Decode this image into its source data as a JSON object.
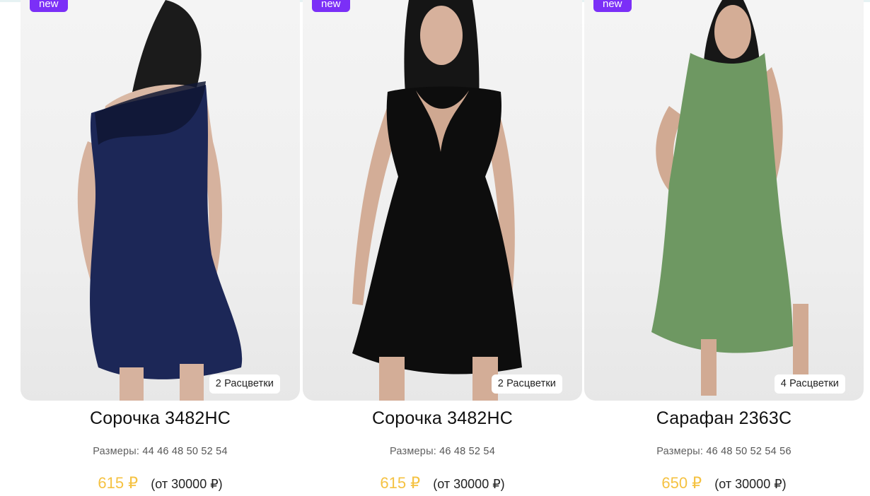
{
  "products": [
    {
      "badge": "new",
      "colors_label": "2 Расцветки",
      "title": "Сорочка 3482НС",
      "sizes_label": "Размеры:",
      "sizes": "44 46 48 50 52 54",
      "price": "615 ₽",
      "min_order": "(от 30000 ₽)",
      "garment_color": "#1c2757"
    },
    {
      "badge": "new",
      "colors_label": "2 Расцветки",
      "title": "Сорочка 3482НС",
      "sizes_label": "Размеры:",
      "sizes": "46 48 52 54",
      "price": "615 ₽",
      "min_order": "(от 30000 ₽)",
      "garment_color": "#0d0d0d"
    },
    {
      "badge": "new",
      "colors_label": "4 Расцветки",
      "title": "Сарафан 2363С",
      "sizes_label": "Размеры:",
      "sizes": "46 48 50 52 54 56",
      "price": "650 ₽",
      "min_order": "(от 30000 ₽)",
      "garment_color": "#6e9862"
    }
  ],
  "colors": {
    "badge": "#7b2ff7",
    "price": "#f5c242"
  }
}
